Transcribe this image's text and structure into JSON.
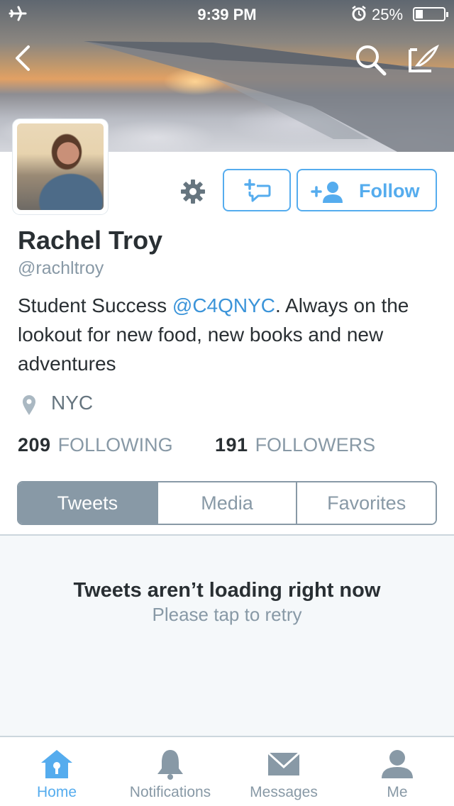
{
  "status_bar": {
    "time": "9:39 PM",
    "battery_percent": "25%",
    "battery_level": 0.25,
    "icons": [
      "airplane-icon",
      "alarm-icon",
      "battery-icon"
    ]
  },
  "nav": {
    "icons": [
      "back-chevron-icon",
      "search-icon",
      "compose-icon"
    ]
  },
  "profile": {
    "name": "Rachel Troy",
    "handle": "@rachltroy",
    "bio_prefix": "Student Success ",
    "bio_mention": "@C4QNYC",
    "bio_suffix": ". Always on the lookout for new food, new books and new adventures",
    "location": "NYC",
    "following_count": "209",
    "following_label": "FOLLOWING",
    "followers_count": "191",
    "followers_label": "FOLLOWERS"
  },
  "actions": {
    "follow_label": "Follow",
    "icons": [
      "gear-icon",
      "direct-message-icon",
      "add-user-icon"
    ]
  },
  "tabs": [
    {
      "label": "Tweets",
      "active": true
    },
    {
      "label": "Media",
      "active": false
    },
    {
      "label": "Favorites",
      "active": false
    }
  ],
  "empty_state": {
    "title": "Tweets aren’t loading right now",
    "subtitle": "Please tap to retry"
  },
  "tab_bar": [
    {
      "label": "Home",
      "icon": "home-icon",
      "active": true
    },
    {
      "label": "Notifications",
      "icon": "bell-icon",
      "active": false
    },
    {
      "label": "Messages",
      "icon": "envelope-icon",
      "active": false
    },
    {
      "label": "Me",
      "icon": "person-icon",
      "active": false
    }
  ],
  "colors": {
    "accent": "#55acee",
    "muted": "#8899a6",
    "text": "#292f33",
    "mention": "#3b94d9",
    "empty_background": "#f5f8fa"
  }
}
